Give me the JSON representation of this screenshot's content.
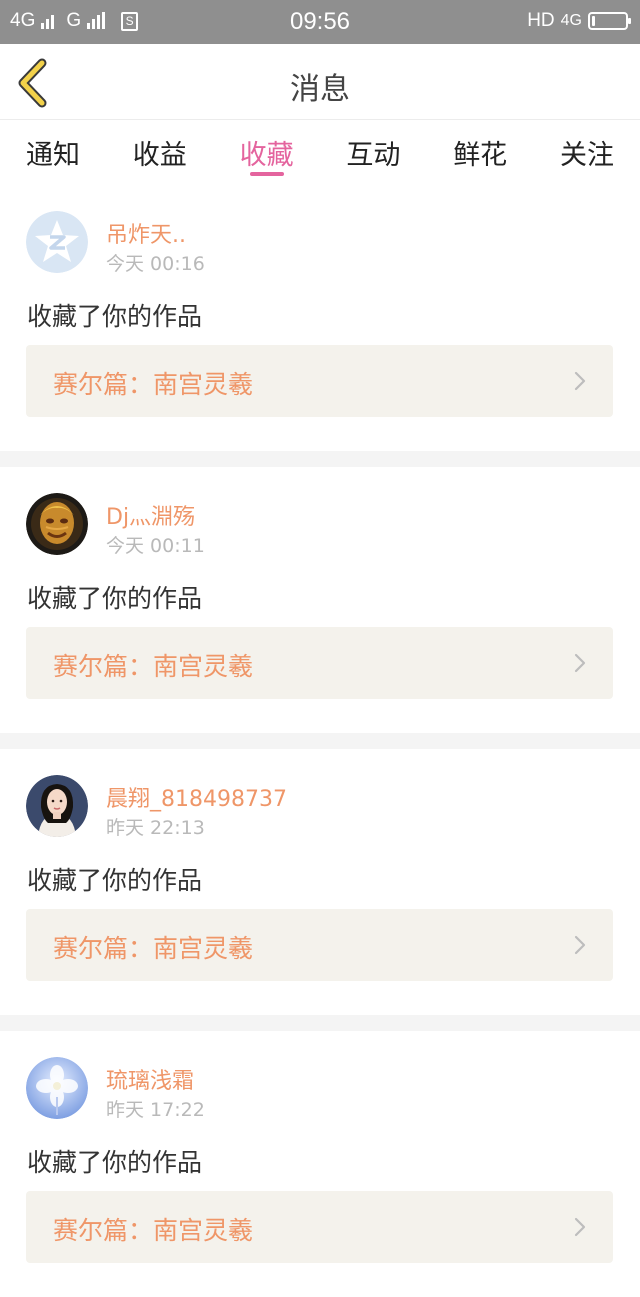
{
  "status_bar": {
    "left_sim1": "4G",
    "left_sim2": "G",
    "sim_badge": "S",
    "time": "09:56",
    "right_label": "HD",
    "right_net": "4G",
    "battery_level": 0.08
  },
  "header": {
    "back_icon": "chevron-left-icon",
    "title": "消息"
  },
  "tabs": [
    {
      "label": "通知",
      "active": false
    },
    {
      "label": "收益",
      "active": false
    },
    {
      "label": "收藏",
      "active": true
    },
    {
      "label": "互动",
      "active": false
    },
    {
      "label": "鲜花",
      "active": false
    },
    {
      "label": "关注",
      "active": false
    }
  ],
  "colors": {
    "accent": "#e4649e",
    "name": "#ef9668",
    "work_bg": "#f4f2ec"
  },
  "notifications": [
    {
      "name": "吊炸天..",
      "time": "今天 00:16",
      "message": "收藏了你的作品",
      "work": "赛尔篇：南宫灵羲",
      "avatar": "default-avatar"
    },
    {
      "name": "Dj灬淵殇",
      "time": "今天 00:11",
      "message": "收藏了你的作品",
      "work": "赛尔篇：南宫灵羲",
      "avatar": "warrior-avatar"
    },
    {
      "name": "晨翔_818498737",
      "time": "昨天 22:13",
      "message": "收藏了你的作品",
      "work": "赛尔篇：南宫灵羲",
      "avatar": "woman-avatar"
    },
    {
      "name": "琉璃浅霜",
      "time": "昨天 17:22",
      "message": "收藏了你的作品",
      "work": "赛尔篇：南宫灵羲",
      "avatar": "flower-avatar"
    }
  ]
}
